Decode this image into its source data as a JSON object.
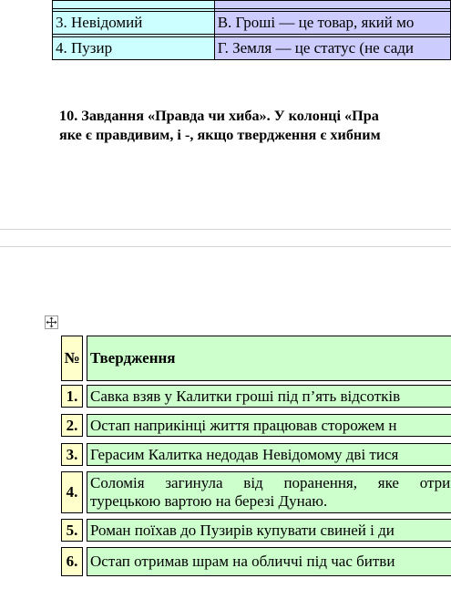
{
  "top_table": {
    "rows": [
      {
        "left": "",
        "right": ""
      },
      {
        "left": "3. Невідомий",
        "right": "В. Гроші — це товар, який мо"
      },
      {
        "left": "4. Пузир",
        "right": "Г. Земля — це статус (не сади"
      }
    ]
  },
  "task": {
    "line1": "10. Завдання  «Правда чи хиба».  У колонці «Пра",
    "line2": "яке є правдивим, і -, якщо твердження є хибним"
  },
  "tf_table": {
    "header": {
      "num": "№",
      "text": "Твердження"
    },
    "rows": [
      {
        "num": "1.",
        "lines": [
          "Савка взяв у Калитки гроші під п’ять відсотків"
        ]
      },
      {
        "num": "2.",
        "lines": [
          "Остап наприкінці життя працював сторожем н"
        ]
      },
      {
        "num": "3.",
        "lines": [
          "Герасим Калитка недодав Невідомому дві тися"
        ]
      },
      {
        "num": "4.",
        "lines": [
          "Соломія загинула від поранення, яке отрим",
          "турецькою вартою на березі Дунаю."
        ]
      },
      {
        "num": "5.",
        "lines": [
          "Роман поїхав до Пузирів купувати свиней і ди"
        ]
      },
      {
        "num": "6.",
        "lines": [
          "Остап отримав шрам на обличчі під час битви"
        ]
      }
    ]
  }
}
